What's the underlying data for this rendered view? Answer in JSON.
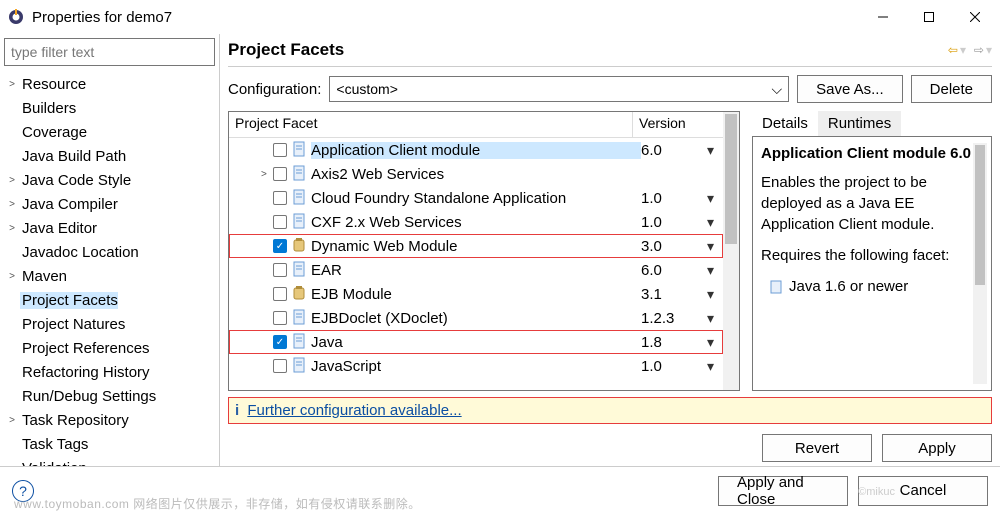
{
  "window": {
    "title": "Properties for demo7"
  },
  "sidebar": {
    "filter_placeholder": "type filter text",
    "items": [
      {
        "label": "Resource",
        "expandable": true
      },
      {
        "label": "Builders"
      },
      {
        "label": "Coverage"
      },
      {
        "label": "Java Build Path"
      },
      {
        "label": "Java Code Style",
        "expandable": true
      },
      {
        "label": "Java Compiler",
        "expandable": true
      },
      {
        "label": "Java Editor",
        "expandable": true
      },
      {
        "label": "Javadoc Location"
      },
      {
        "label": "Maven",
        "expandable": true
      },
      {
        "label": "Project Facets",
        "selected": true
      },
      {
        "label": "Project Natures"
      },
      {
        "label": "Project References"
      },
      {
        "label": "Refactoring History"
      },
      {
        "label": "Run/Debug Settings"
      },
      {
        "label": "Task Repository",
        "expandable": true
      },
      {
        "label": "Task Tags"
      },
      {
        "label": "Validation"
      }
    ]
  },
  "content": {
    "title": "Project Facets",
    "config_label": "Configuration:",
    "config_value": "<custom>",
    "save_as": "Save As...",
    "delete": "Delete",
    "table": {
      "col_facet": "Project Facet",
      "col_version": "Version",
      "rows": [
        {
          "name": "Application Client module",
          "version": "6.0",
          "checked": false,
          "selected": true,
          "icon": "page"
        },
        {
          "name": "Axis2 Web Services",
          "version": "",
          "checked": false,
          "expandable": true,
          "icon": "page"
        },
        {
          "name": "Cloud Foundry Standalone Application",
          "version": "1.0",
          "checked": false,
          "icon": "page"
        },
        {
          "name": "CXF 2.x Web Services",
          "version": "1.0",
          "checked": false,
          "icon": "page"
        },
        {
          "name": "Dynamic Web Module",
          "version": "3.0",
          "checked": true,
          "icon": "jar",
          "highlight": true
        },
        {
          "name": "EAR",
          "version": "6.0",
          "checked": false,
          "icon": "page"
        },
        {
          "name": "EJB Module",
          "version": "3.1",
          "checked": false,
          "icon": "jar"
        },
        {
          "name": "EJBDoclet (XDoclet)",
          "version": "1.2.3",
          "checked": false,
          "icon": "page"
        },
        {
          "name": "Java",
          "version": "1.8",
          "checked": true,
          "icon": "page",
          "highlight": true
        },
        {
          "name": "JavaScript",
          "version": "1.0",
          "checked": false,
          "icon": "page"
        }
      ]
    },
    "further_label": "Further configuration available...",
    "revert": "Revert",
    "apply": "Apply"
  },
  "details": {
    "tab_details": "Details",
    "tab_runtimes": "Runtimes",
    "title": "Application Client module 6.0",
    "desc": "Enables the project to be deployed as a Java EE Application Client module.",
    "req_label": "Requires the following facet:",
    "req_item": "Java 1.6 or newer"
  },
  "footer": {
    "apply_close": "Apply and Close",
    "cancel": "Cancel"
  },
  "watermark": "www.toymoban.com  网络图片仅供展示，非存储，如有侵权请联系删除。",
  "watermark2": "©mikuc"
}
